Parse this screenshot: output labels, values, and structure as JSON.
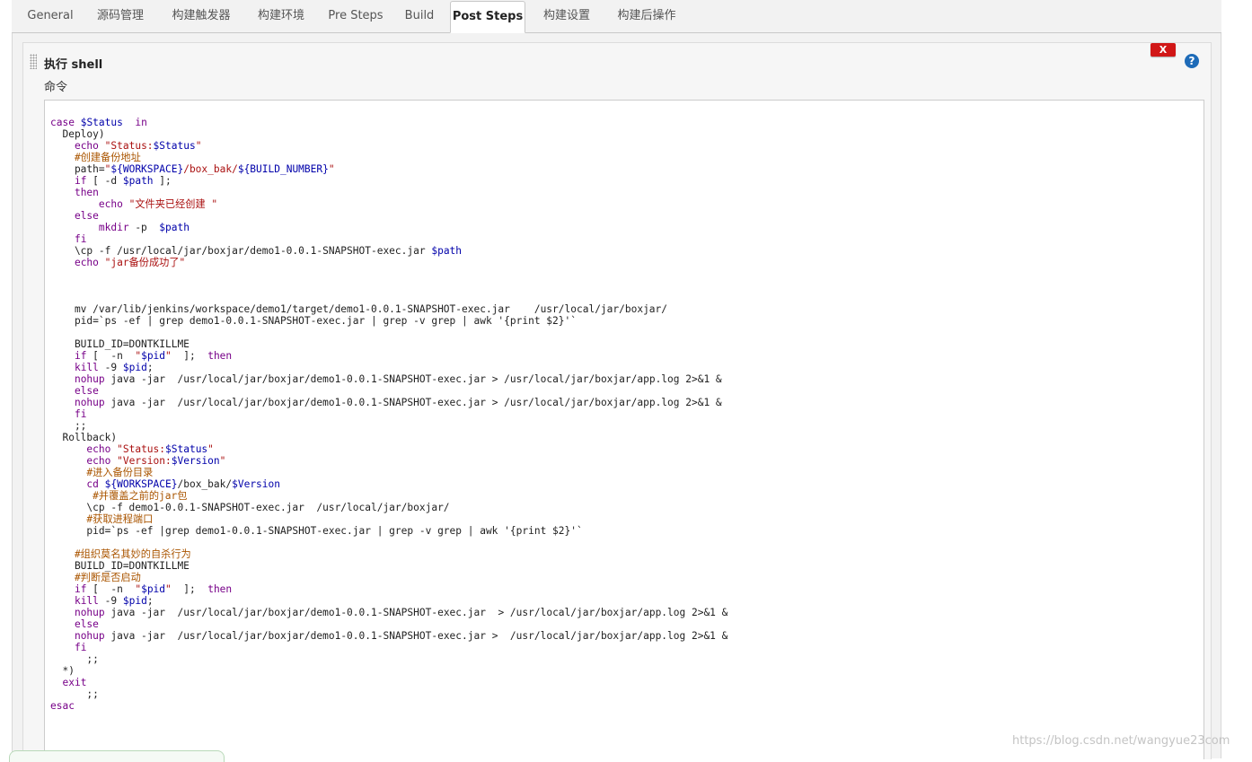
{
  "tabs": [
    {
      "label": "General",
      "active": false
    },
    {
      "label": "源码管理",
      "active": false
    },
    {
      "label": "构建触发器",
      "active": false
    },
    {
      "label": "构建环境",
      "active": false
    },
    {
      "label": "Pre Steps",
      "active": false
    },
    {
      "label": "Build",
      "active": false
    },
    {
      "label": "Post Steps",
      "active": true
    },
    {
      "label": "构建设置",
      "active": false
    },
    {
      "label": "构建后操作",
      "active": false
    }
  ],
  "section": {
    "title": "执行 shell",
    "command_label": "命令",
    "delete_label": "X",
    "help_label": "?"
  },
  "code_lines": [
    "case $Status  in",
    "  Deploy)",
    "    echo \"Status:$Status\"",
    "    #创建备份地址",
    "    path=\"${WORKSPACE}/box_bak/${BUILD_NUMBER}\"",
    "    if [ -d $path ];",
    "    then",
    "        echo \"文件夹已经创建 \"",
    "    else",
    "        mkdir -p  $path",
    "    fi",
    "    \\cp -f /usr/local/jar/boxjar/demo1-0.0.1-SNAPSHOT-exec.jar $path",
    "    echo \"jar备份成功了\"",
    "",
    "",
    "",
    "    mv /var/lib/jenkins/workspace/demo1/target/demo1-0.0.1-SNAPSHOT-exec.jar    /usr/local/jar/boxjar/",
    "    pid=`ps -ef | grep demo1-0.0.1-SNAPSHOT-exec.jar | grep -v grep | awk '{print $2}'`",
    "",
    "    BUILD_ID=DONTKILLME",
    "    if [  -n  \"$pid\"  ];  then",
    "    kill -9 $pid;",
    "    nohup java -jar  /usr/local/jar/boxjar/demo1-0.0.1-SNAPSHOT-exec.jar > /usr/local/jar/boxjar/app.log 2>&1 &",
    "    else",
    "    nohup java -jar  /usr/local/jar/boxjar/demo1-0.0.1-SNAPSHOT-exec.jar > /usr/local/jar/boxjar/app.log 2>&1 &",
    "    fi",
    "    ;;",
    "  Rollback)",
    "      echo \"Status:$Status\"",
    "      echo \"Version:$Version\"",
    "      #进入备份目录",
    "      cd ${WORKSPACE}/box_bak/$Version",
    "       #并覆盖之前的jar包",
    "      \\cp -f demo1-0.0.1-SNAPSHOT-exec.jar  /usr/local/jar/boxjar/",
    "      #获取进程端口",
    "      pid=`ps -ef |grep demo1-0.0.1-SNAPSHOT-exec.jar | grep -v grep | awk '{print $2}'`",
    "",
    "    #组织莫名其妙的自杀行为",
    "    BUILD_ID=DONTKILLME",
    "    #判断是否启动",
    "    if [  -n  \"$pid\"  ];  then",
    "    kill -9 $pid;",
    "    nohup java -jar  /usr/local/jar/boxjar/demo1-0.0.1-SNAPSHOT-exec.jar  > /usr/local/jar/boxjar/app.log 2>&1 &",
    "    else",
    "    nohup java -jar  /usr/local/jar/boxjar/demo1-0.0.1-SNAPSHOT-exec.jar >  /usr/local/jar/boxjar/app.log 2>&1 &",
    "    fi",
    "      ;;",
    "  *)",
    "  exit",
    "      ;;",
    "esac"
  ],
  "watermark": "https://blog.csdn.net/wangyue23com"
}
